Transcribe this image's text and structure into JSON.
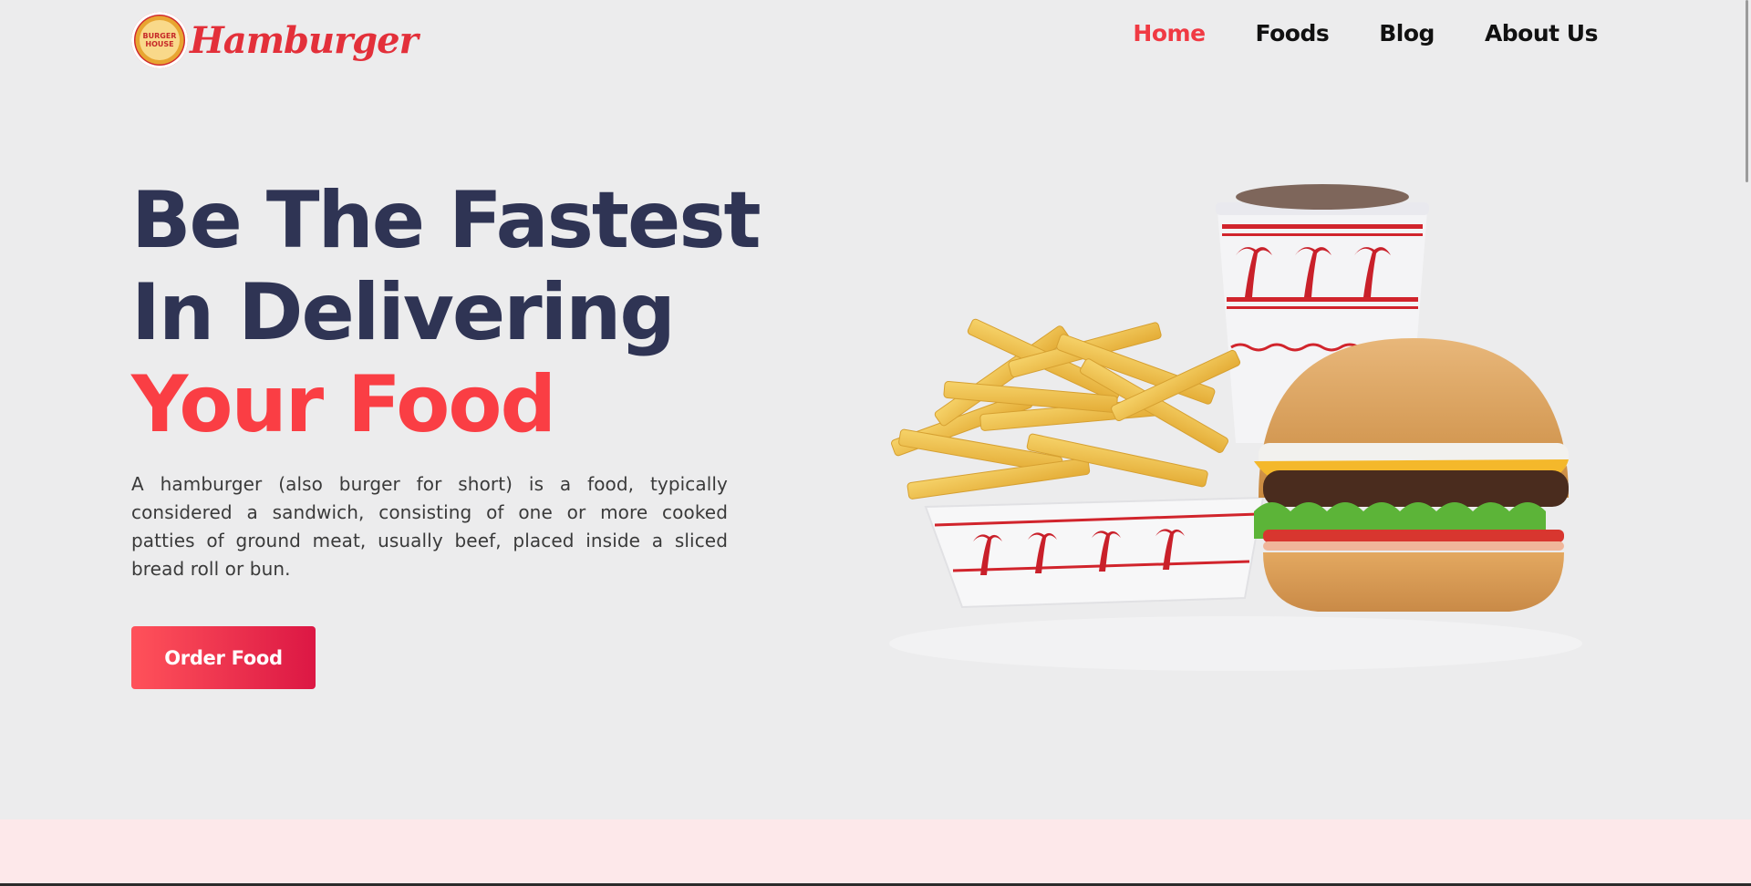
{
  "brand": {
    "name": "Hamburger",
    "badge_line1": "BURGER",
    "badge_line2": "HOUSE"
  },
  "nav": {
    "items": [
      {
        "label": "Home",
        "active": true
      },
      {
        "label": "Foods",
        "active": false
      },
      {
        "label": "Blog",
        "active": false
      },
      {
        "label": "About Us",
        "active": false
      }
    ]
  },
  "hero": {
    "title_line1": "Be The Fastest",
    "title_line2": "In Delivering",
    "title_line3": "Your Food",
    "description": "A hamburger (also burger for short) is a food, typically considered a sandwich, consisting of one or more cooked patties of ground meat, usually beef, placed inside a sliced bread roll or bun.",
    "button_label": "Order Food"
  },
  "colors": {
    "accent": "#fa3e44",
    "heading": "#2f3454",
    "background": "#ececed",
    "footer_band": "#fde8ea"
  }
}
